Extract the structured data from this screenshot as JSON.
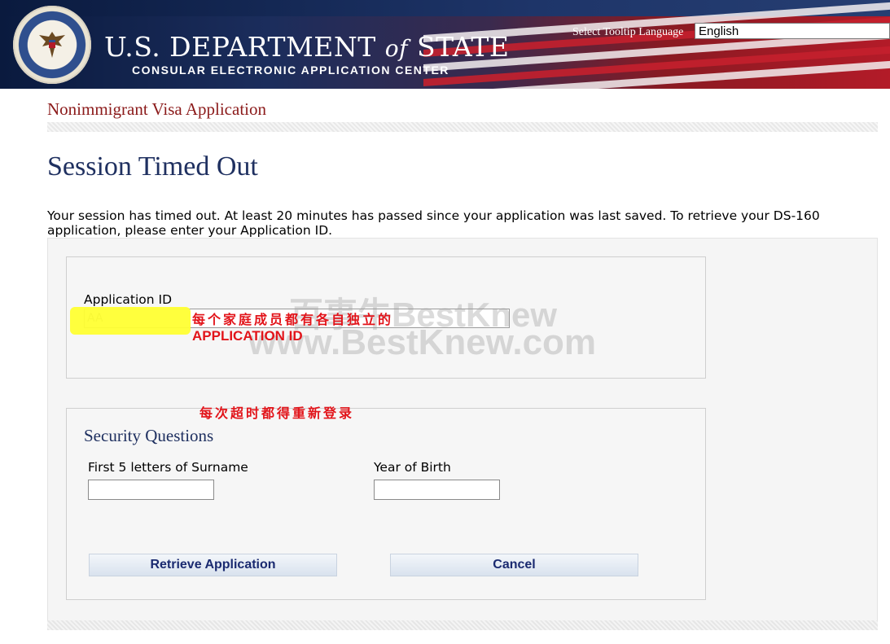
{
  "header": {
    "department_title": "U.S. DEPARTMENT",
    "department_of": "of",
    "department_state": "STATE",
    "subtitle": "CONSULAR ELECTRONIC APPLICATION CENTER",
    "tooltip_language_label": "Select Tooltip Language",
    "tooltip_language_value": "English"
  },
  "page": {
    "app_title": "Nonimmigrant Visa Application",
    "heading": "Session Timed Out",
    "intro": "Your session has timed out. At least 20 minutes has passed since your application was last saved. To retrieve your DS-160 application, please enter your Application ID."
  },
  "application_id": {
    "label": "Application ID",
    "value": "AA"
  },
  "security": {
    "heading": "Security Questions",
    "surname_label": "First 5 letters of Surname",
    "yob_label": "Year of Birth"
  },
  "buttons": {
    "retrieve": "Retrieve Application",
    "cancel": "Cancel"
  },
  "annotations": {
    "note1_line1": "每个家庭成员都有各自独立的",
    "note1_line2": "APPLICATION ID",
    "note2": "每次超时都得重新登录"
  },
  "watermark": {
    "line1": "百事牛BestKnew",
    "line2": "www.BestKnew.com"
  },
  "colors": {
    "heading_navy": "#1f3060",
    "app_title_red": "#8b1a1a",
    "annotation_red": "#e2141a",
    "highlight_yellow": "#ffff33",
    "button_text": "#1a2a70"
  }
}
